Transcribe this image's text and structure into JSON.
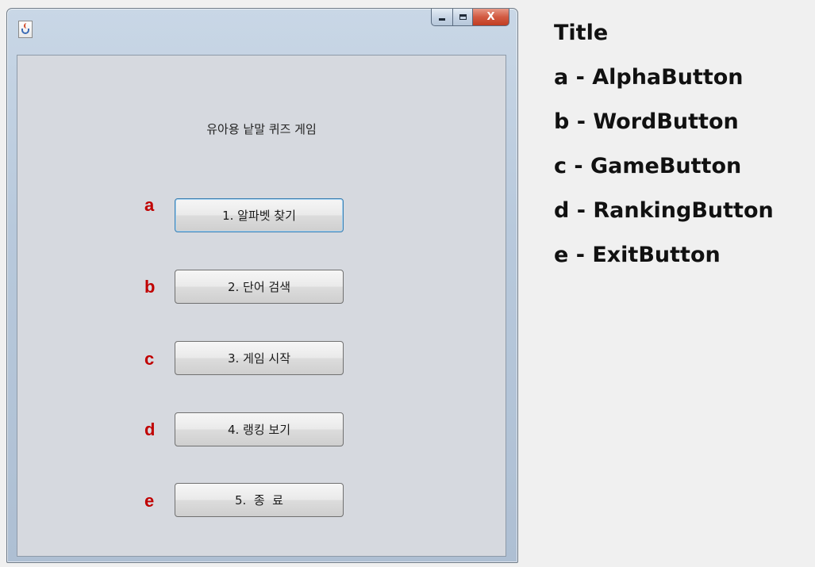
{
  "window": {
    "title": "",
    "caption": {
      "minimize_label": "",
      "maximize_label": "",
      "close_label": "X"
    }
  },
  "main": {
    "title": "유아용 낱말 퀴즈 게임",
    "buttons": [
      {
        "marker": "a",
        "label": "1. 알파벳 찾기",
        "focused": true
      },
      {
        "marker": "b",
        "label": "2. 단어 검색",
        "focused": false
      },
      {
        "marker": "c",
        "label": "3. 게임 시작",
        "focused": false
      },
      {
        "marker": "d",
        "label": "4. 랭킹 보기",
        "focused": false
      },
      {
        "marker": "e",
        "label": "5.  종  료",
        "focused": false
      }
    ]
  },
  "legend": {
    "items": [
      "Title",
      "a - AlphaButton",
      "b - WordButton",
      "c - GameButton",
      "d - RankingButton",
      "e - ExitButton"
    ]
  },
  "colors": {
    "marker": "#c00000",
    "client_bg": "#d6d9df",
    "close_button": "#c13d22"
  }
}
